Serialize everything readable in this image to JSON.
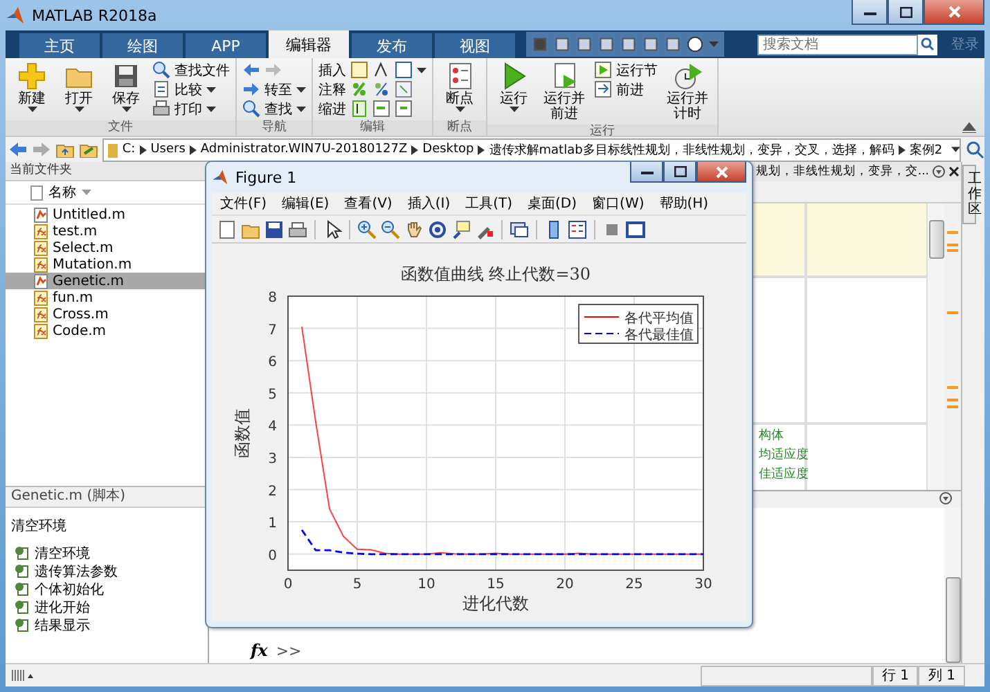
{
  "window": {
    "title": "MATLAB R2018a"
  },
  "tabs": [
    {
      "label": "主页",
      "selected": false
    },
    {
      "label": "绘图",
      "selected": false
    },
    {
      "label": "APP",
      "selected": false
    },
    {
      "label": "编辑器",
      "selected": true
    },
    {
      "label": "发布",
      "selected": false
    },
    {
      "label": "视图",
      "selected": false
    }
  ],
  "search": {
    "placeholder": "搜索文档"
  },
  "login": "登录",
  "ribbon": [
    {
      "title": "文件",
      "items": [
        {
          "kind": "large",
          "label": "新建",
          "menu": true
        },
        {
          "kind": "large",
          "label": "打开",
          "menu": true
        },
        {
          "kind": "large",
          "label": "保存",
          "menu": true
        },
        {
          "kind": "column",
          "rows": [
            {
              "label": "查找文件",
              "menu": false
            },
            {
              "label": "比较",
              "menu": true
            },
            {
              "label": "打印",
              "menu": true
            }
          ]
        }
      ]
    },
    {
      "title": "导航",
      "items": [
        {
          "kind": "column",
          "rows": [
            {
              "kind": "arrows"
            },
            {
              "label": "转至",
              "menu": true
            },
            {
              "label": "查找",
              "menu": true
            }
          ]
        }
      ]
    },
    {
      "title": "编辑",
      "items": [
        {
          "kind": "column",
          "rows": [
            {
              "label": "插入",
              "kind": "icons",
              "menu": true
            },
            {
              "label": "注释",
              "kind": "icons",
              "menu": false
            },
            {
              "label": "缩进",
              "kind": "icons",
              "menu": false
            }
          ]
        }
      ]
    },
    {
      "title": "断点",
      "items": [
        {
          "kind": "large",
          "label": "断点",
          "menu": true
        }
      ]
    },
    {
      "title": "运行",
      "items": [
        {
          "kind": "large",
          "label": "运行",
          "menu": true
        },
        {
          "kind": "large",
          "label": "运行并前进",
          "menu": false
        },
        {
          "kind": "column",
          "rows": [
            {
              "label": "运行节",
              "menu": false
            },
            {
              "label": "前进",
              "menu": false
            }
          ]
        },
        {
          "kind": "large",
          "label": "运行并计时",
          "menu": false
        }
      ]
    }
  ],
  "address": [
    "C:",
    "Users",
    "Administrator.WIN7U-20180127Z",
    "Desktop",
    "遗传求解matlab多目标线性规划，非线性规划，变异，交叉，选择，解码",
    "案例2"
  ],
  "folder": {
    "title": "当前文件夹",
    "column": "名称",
    "files": [
      {
        "name": "Untitled.m",
        "kind": "script",
        "selected": false
      },
      {
        "name": "test.m",
        "kind": "function",
        "selected": false
      },
      {
        "name": "Select.m",
        "kind": "function",
        "selected": false
      },
      {
        "name": "Mutation.m",
        "kind": "function",
        "selected": false
      },
      {
        "name": "Genetic.m",
        "kind": "script",
        "selected": true
      },
      {
        "name": "fun.m",
        "kind": "function",
        "selected": false
      },
      {
        "name": "Cross.m",
        "kind": "function",
        "selected": false
      },
      {
        "name": "Code.m",
        "kind": "function",
        "selected": false
      }
    ]
  },
  "details": {
    "title": "Genetic.m  (脚本)",
    "heading": "清空环境",
    "sections": [
      "清空环境",
      "遗传算法参数",
      "个体初始化",
      "进化开始",
      "结果显示"
    ]
  },
  "editor": {
    "title": "规划，非线性规划，变异，交...",
    "comments": [
      "构体",
      "均适应度",
      "佳适应度"
    ]
  },
  "workspace_tab": "工作区",
  "command": {
    "fx": "fx",
    "prompt": ">>"
  },
  "status": {
    "row": "行 1",
    "col": "列 1"
  },
  "figure": {
    "title": "Figure 1",
    "menus": [
      "文件(F)",
      "编辑(E)",
      "查看(V)",
      "插入(I)",
      "工具(T)",
      "桌面(D)",
      "窗口(W)",
      "帮助(H)"
    ],
    "chart_data": {
      "type": "line",
      "title": "函数值曲线  终止代数=30",
      "xlabel": "进化代数",
      "ylabel": "函数值",
      "x": [
        1,
        2,
        3,
        4,
        5,
        6,
        7,
        8,
        9,
        10,
        11,
        12,
        13,
        14,
        15,
        16,
        17,
        18,
        19,
        20,
        21,
        22,
        23,
        24,
        25,
        26,
        27,
        28,
        29,
        30
      ],
      "series": [
        {
          "name": "各代平均值",
          "color": "#ff0000",
          "line_style": "solid",
          "values": [
            7.05,
            4.1,
            1.4,
            0.55,
            0.15,
            0.13,
            0.03,
            0,
            0,
            0,
            0.04,
            0.01,
            0,
            0,
            0.03,
            0,
            0,
            0,
            0,
            0,
            0.03,
            0,
            0,
            0,
            0,
            0,
            0,
            0,
            0,
            0
          ]
        },
        {
          "name": "各代最佳值",
          "color": "#0000ff",
          "line_style": "dashed",
          "values": [
            0.75,
            0.12,
            0.12,
            0.05,
            0.01,
            0,
            0,
            0,
            0,
            0,
            0,
            0,
            0,
            0,
            0,
            0,
            0,
            0,
            0,
            0,
            0,
            0,
            0,
            0,
            0,
            0,
            0,
            0,
            0,
            0
          ]
        }
      ],
      "xlim": [
        0,
        30
      ],
      "ylim": [
        -0.5,
        8
      ],
      "xticks": [
        0,
        5,
        10,
        15,
        20,
        25,
        30
      ],
      "yticks": [
        0,
        1,
        2,
        3,
        4,
        5,
        6,
        7,
        8
      ],
      "grid": true,
      "legend": "upper right"
    }
  }
}
